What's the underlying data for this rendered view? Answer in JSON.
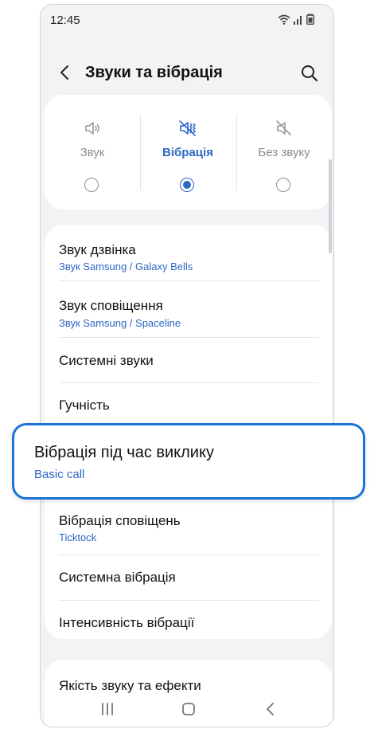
{
  "status_bar": {
    "time": "12:45"
  },
  "header": {
    "title": "Звуки та вібрація"
  },
  "modes": [
    {
      "label": "Звук",
      "icon": "speaker-icon",
      "selected": false
    },
    {
      "label": "Вібрація",
      "icon": "vibrate-icon",
      "selected": true
    },
    {
      "label": "Без звуку",
      "icon": "mute-icon",
      "selected": false
    }
  ],
  "settings": [
    {
      "title": "Звук дзвінка",
      "subtitle": "Звук Samsung / Galaxy Bells"
    },
    {
      "title": "Звук сповіщення",
      "subtitle": "Звук Samsung / Spaceline"
    },
    {
      "title": "Системні звуки"
    },
    {
      "title": "Гучність"
    },
    {
      "title": "Вібрація під час виклику",
      "subtitle": "Basic call"
    },
    {
      "title": "Вібрація сповіщень",
      "subtitle": "Ticktock"
    },
    {
      "title": "Системна вібрація"
    },
    {
      "title": "Інтенсивність вібрації"
    },
    {
      "title": "Якість звуку та ефекти"
    }
  ],
  "colors": {
    "accent": "#2d68c4",
    "highlight_border": "#1b73d6",
    "background": "#f3f3f5"
  }
}
